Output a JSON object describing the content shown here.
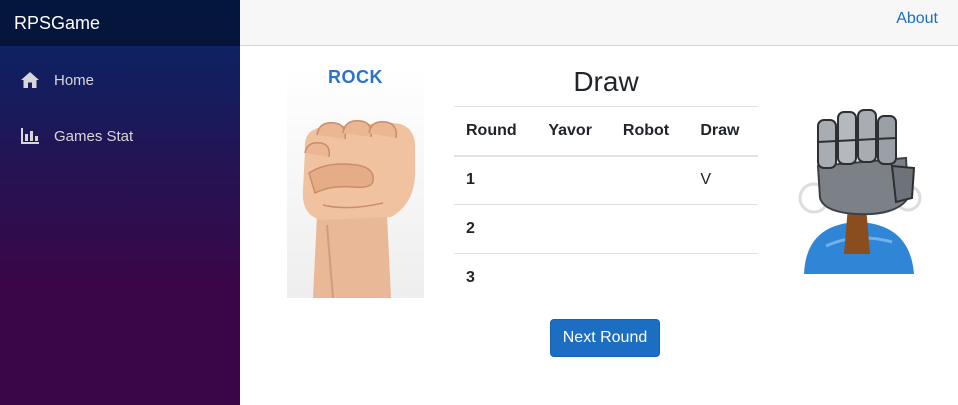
{
  "sidebar": {
    "brand": "RPSGame",
    "items": [
      {
        "label": "Home",
        "icon": "home-icon"
      },
      {
        "label": "Games Stat",
        "icon": "bar-chart-icon"
      }
    ]
  },
  "topbar": {
    "about_label": "About"
  },
  "game": {
    "player_choice_caption": "ROCK",
    "result_title": "Draw",
    "table": {
      "headers": [
        "Round",
        "Yavor",
        "Robot",
        "Draw"
      ],
      "rows": [
        {
          "round": "1",
          "yavor": "",
          "robot": "",
          "draw": "V"
        },
        {
          "round": "2",
          "yavor": "",
          "robot": "",
          "draw": ""
        },
        {
          "round": "3",
          "yavor": "",
          "robot": "",
          "draw": ""
        }
      ]
    },
    "next_round_label": "Next Round"
  },
  "colors": {
    "accent": "#1b6ec2",
    "sidebar_top": "#052767",
    "sidebar_bottom": "#3a0647"
  }
}
